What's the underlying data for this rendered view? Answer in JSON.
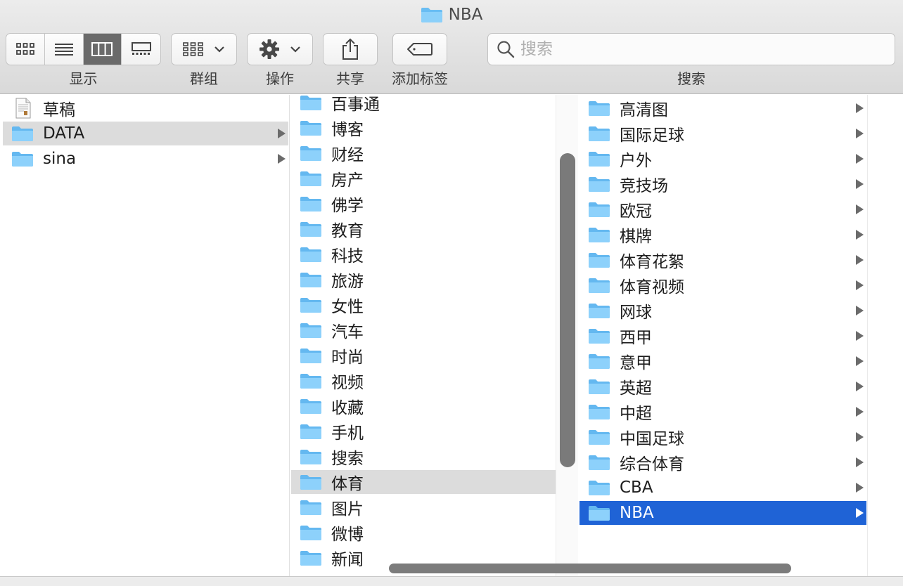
{
  "window": {
    "title": "NBA",
    "title_icon": "folder-icon"
  },
  "toolbar": {
    "view_label": "显示",
    "group_label": "群组",
    "action_label": "操作",
    "share_label": "共享",
    "tag_label": "添加标签",
    "search_label": "搜索",
    "search_placeholder": "搜索",
    "active_view": "column"
  },
  "colors": {
    "selection_blue": "#1f63d6",
    "selection_gray": "#dcdcdc",
    "folder": "#6cc0f5"
  },
  "column1": [
    {
      "name": "草稿",
      "kind": "document",
      "selected": false,
      "has_children": false
    },
    {
      "name": "DATA",
      "kind": "folder",
      "selected": true,
      "has_children": true
    },
    {
      "name": "sina",
      "kind": "folder",
      "selected": false,
      "has_children": true
    }
  ],
  "column2": [
    {
      "name": "百事通",
      "kind": "folder",
      "has_children": true
    },
    {
      "name": "博客",
      "kind": "folder",
      "has_children": true
    },
    {
      "name": "财经",
      "kind": "folder",
      "has_children": true
    },
    {
      "name": "房产",
      "kind": "folder",
      "has_children": true
    },
    {
      "name": "佛学",
      "kind": "folder",
      "has_children": true
    },
    {
      "name": "教育",
      "kind": "folder",
      "has_children": true
    },
    {
      "name": "科技",
      "kind": "folder",
      "has_children": true
    },
    {
      "name": "旅游",
      "kind": "folder",
      "has_children": true
    },
    {
      "name": "女性",
      "kind": "folder",
      "has_children": true
    },
    {
      "name": "汽车",
      "kind": "folder",
      "has_children": true
    },
    {
      "name": "时尚",
      "kind": "folder",
      "has_children": true
    },
    {
      "name": "视频",
      "kind": "folder",
      "has_children": true
    },
    {
      "name": "收藏",
      "kind": "folder",
      "has_children": true
    },
    {
      "name": "手机",
      "kind": "folder",
      "has_children": true
    },
    {
      "name": "搜索",
      "kind": "folder",
      "has_children": true
    },
    {
      "name": "体育",
      "kind": "folder",
      "has_children": true,
      "selected": true
    },
    {
      "name": "图片",
      "kind": "folder",
      "has_children": true
    },
    {
      "name": "微博",
      "kind": "folder",
      "has_children": true
    },
    {
      "name": "新闻",
      "kind": "folder",
      "has_children": true
    }
  ],
  "column3": [
    {
      "name": "高清图",
      "kind": "folder",
      "has_children": true
    },
    {
      "name": "国际足球",
      "kind": "folder",
      "has_children": true
    },
    {
      "name": "户外",
      "kind": "folder",
      "has_children": true
    },
    {
      "name": "竞技场",
      "kind": "folder",
      "has_children": true
    },
    {
      "name": "欧冠",
      "kind": "folder",
      "has_children": true
    },
    {
      "name": "棋牌",
      "kind": "folder",
      "has_children": true
    },
    {
      "name": "体育花絮",
      "kind": "folder",
      "has_children": true
    },
    {
      "name": "体育视频",
      "kind": "folder",
      "has_children": true
    },
    {
      "name": "网球",
      "kind": "folder",
      "has_children": true
    },
    {
      "name": "西甲",
      "kind": "folder",
      "has_children": true
    },
    {
      "name": "意甲",
      "kind": "folder",
      "has_children": true
    },
    {
      "name": "英超",
      "kind": "folder",
      "has_children": true
    },
    {
      "name": "中超",
      "kind": "folder",
      "has_children": true
    },
    {
      "name": "中国足球",
      "kind": "folder",
      "has_children": true
    },
    {
      "name": "综合体育",
      "kind": "folder",
      "has_children": true
    },
    {
      "name": "CBA",
      "kind": "folder",
      "has_children": true
    },
    {
      "name": "NBA",
      "kind": "folder",
      "has_children": true,
      "selected": true
    }
  ]
}
